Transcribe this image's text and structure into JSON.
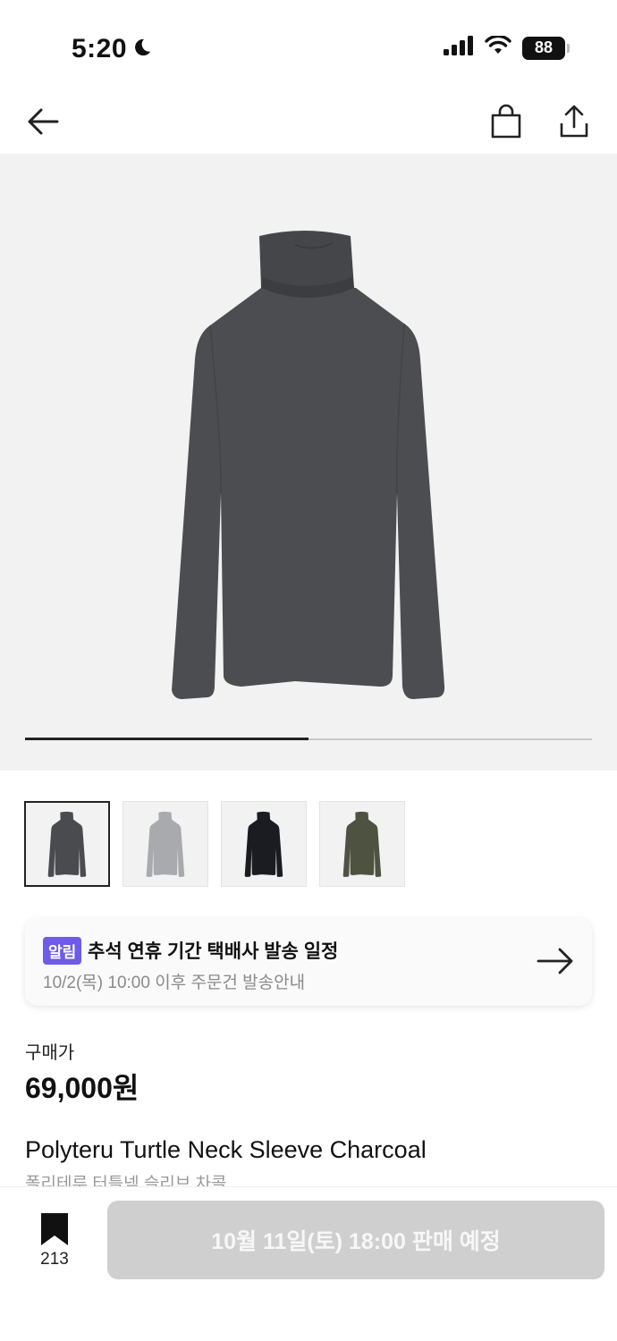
{
  "status_bar": {
    "time": "5:20",
    "battery": "88"
  },
  "nav": {
    "back_icon": "arrow-left-icon",
    "bag_icon": "shopping-bag-icon",
    "share_icon": "share-icon"
  },
  "hero": {
    "image_alt": "charcoal turtleneck",
    "carousel_progress": 0.5
  },
  "thumbnails": [
    {
      "color_name": "charcoal",
      "color": "#4a4b4f",
      "selected": true
    },
    {
      "color_name": "light-gray",
      "color": "#a9aaad",
      "selected": false
    },
    {
      "color_name": "black",
      "color": "#1a1c22",
      "selected": false
    },
    {
      "color_name": "olive",
      "color": "#4e5240",
      "selected": false
    }
  ],
  "notice": {
    "badge": "알림",
    "title": "추석 연휴 기간 택배사 발송 일정",
    "subtitle": "10/2(목) 10:00 이후 주문건 발송안내"
  },
  "price": {
    "label": "구매가",
    "value": "69,000원"
  },
  "product": {
    "name_en": "Polyteru Turtle Neck Sleeve Charcoal",
    "name_ko": "폴리테루 터틀넥 슬리브 차콜"
  },
  "bottom_bar": {
    "bookmark_count": "213",
    "buy_label": "10월 11일(토) 18:00 판매 예정"
  },
  "colors": {
    "accent": "#6c5ce7",
    "button_disabled": "#cfcfcf",
    "hero_bg": "#f2f2f2"
  }
}
